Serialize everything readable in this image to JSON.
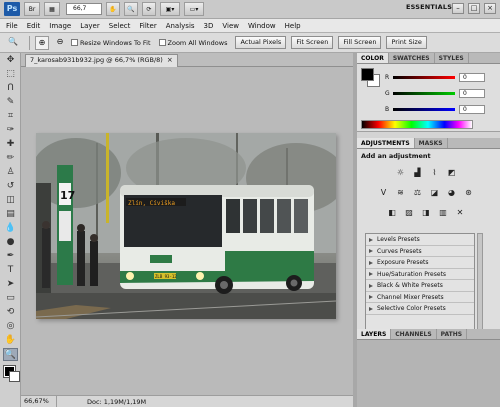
{
  "app": {
    "logo": "Ps",
    "zoom_value": "66,7",
    "workspace": "ESSENTIALS",
    "win_minimize": "–",
    "win_restore": "□",
    "win_close": "×"
  },
  "menu": [
    "File",
    "Edit",
    "Image",
    "Layer",
    "Select",
    "Filter",
    "Analysis",
    "3D",
    "View",
    "Window",
    "Help"
  ],
  "options": {
    "tool_icon": "zoom-icon",
    "resize_windows_label": "Resize Windows To Fit",
    "zoom_all_windows_label": "Zoom All Windows",
    "actual_pixels_label": "Actual Pixels",
    "fit_screen_label": "Fit Screen",
    "fill_screen_label": "Fill Screen",
    "print_size_label": "Print Size"
  },
  "document": {
    "tab_title": "7_karosab931b932.jpg @ 66,7% (RGB/8)",
    "tab_close": "×",
    "bus_display": "Zlín, Cíviška",
    "plate": "ZLB 93-12",
    "stop_sign": "17",
    "zoom_status": "66,67%",
    "doc_info": "Doc: 1,19M/1,19M"
  },
  "panels": {
    "color_tabs": [
      "COLOR",
      "SWATCHES",
      "STYLES"
    ],
    "color": {
      "r_label": "R",
      "g_label": "G",
      "b_label": "B",
      "r_value": "0",
      "g_value": "0",
      "b_value": "0",
      "fg": "#000000",
      "bg": "#ffffff"
    },
    "adjust_tabs": [
      "ADJUSTMENTS",
      "MASKS"
    ],
    "adjust_title": "Add an adjustment",
    "presets": [
      "Levels Presets",
      "Curves Presets",
      "Exposure Presets",
      "Hue/Saturation Presets",
      "Black & White Presets",
      "Channel Mixer Presets",
      "Selective Color Presets"
    ],
    "layer_tabs": [
      "LAYERS",
      "CHANNELS",
      "PATHS"
    ]
  }
}
